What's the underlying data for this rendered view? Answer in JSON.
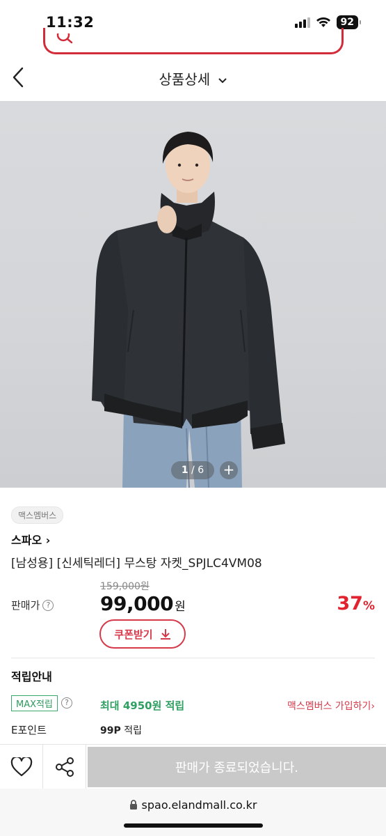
{
  "status_bar": {
    "time": "11:32",
    "battery": "92"
  },
  "header": {
    "title": "상품상세"
  },
  "gallery": {
    "current": "1",
    "separator": " / ",
    "total": "6",
    "plus": "+"
  },
  "product": {
    "badge": "맥스멤버스",
    "brand": "스파오 ›",
    "name": "[남성용] [신세틱레더] 무스탕 자켓_SPJLC4VM08",
    "original_price": "159,000원",
    "price_label": "판매가",
    "price": "99,000",
    "currency": "원",
    "discount": "37",
    "discount_unit": "%",
    "coupon_label": "쿠폰받기"
  },
  "points": {
    "title": "적립안내",
    "max_badge": "MAX적립",
    "max_value": "최대 4950원 적립",
    "join_link": "맥스멤버스 가입하기›",
    "epoint_label": "E포인트",
    "epoint_amount": "99P",
    "epoint_suffix": " 적립"
  },
  "action_bar": {
    "sold_out": "판매가 종료되었습니다."
  },
  "browser": {
    "url": "spao.elandmall.co.kr"
  },
  "colors": {
    "accent": "#d6394a",
    "discount": "#e1232f",
    "points": "#2fa062"
  },
  "icons": [
    "search-icon",
    "back-icon",
    "chevron-down-icon",
    "heart-icon",
    "share-icon",
    "lock-icon",
    "download-icon",
    "help-icon"
  ]
}
